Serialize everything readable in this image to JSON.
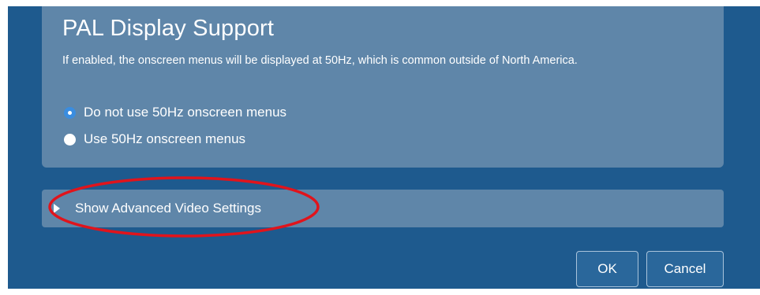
{
  "pal_section": {
    "title": "PAL Display Support",
    "description": "If enabled, the onscreen menus will be displayed at 50Hz, which is common outside of North America.",
    "options": [
      {
        "label": "Do not use 50Hz onscreen menus",
        "selected": true
      },
      {
        "label": "Use 50Hz onscreen menus",
        "selected": false
      }
    ]
  },
  "advanced": {
    "label": "Show Advanced Video Settings",
    "expanded": false,
    "arrow_icon": "triangle-right-icon",
    "highlight_color": "#e0141c"
  },
  "footer": {
    "ok_label": "OK",
    "cancel_label": "Cancel"
  },
  "colors": {
    "background": "#1e5a8e",
    "panel": "#5f86a9",
    "radio_selected": "#3a8de0",
    "text": "#ffffff"
  }
}
